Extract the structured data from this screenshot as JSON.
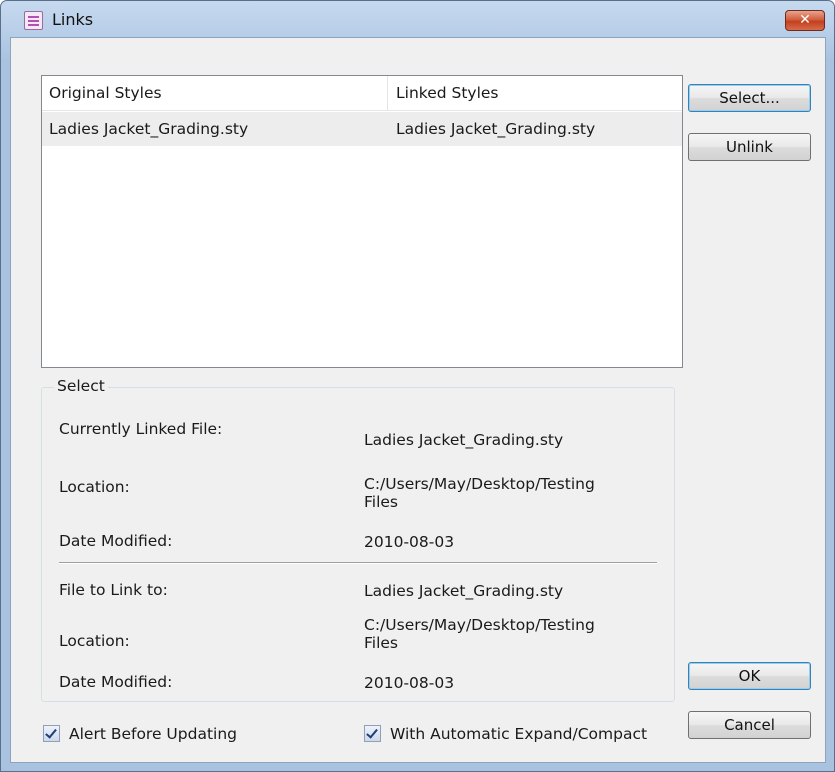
{
  "window": {
    "title": "Links",
    "close_symbol": "✕",
    "icon": "style-file-icon"
  },
  "list": {
    "columns": [
      "Original Styles",
      "Linked Styles"
    ],
    "rows": [
      {
        "original": "Ladies Jacket_Grading.sty",
        "linked": "Ladies Jacket_Grading.sty",
        "selected": true
      }
    ]
  },
  "buttons": {
    "select": "Select...",
    "unlink": "Unlink",
    "ok": "OK",
    "cancel": "Cancel"
  },
  "group": {
    "title": "Select",
    "current": {
      "file_label": "Currently Linked File:",
      "file_value": "Ladies Jacket_Grading.sty",
      "location_label": "Location:",
      "location_value_line1": "C:/Users/May/Desktop/Testing",
      "location_value_line2": "Files",
      "date_label": "Date Modified:",
      "date_value": "2010-08-03"
    },
    "target": {
      "file_label": "File to Link to:",
      "file_value": "Ladies Jacket_Grading.sty",
      "location_label": "Location:",
      "location_value_line1": "C:/Users/May/Desktop/Testing",
      "location_value_line2": "Files",
      "date_label": "Date Modified:",
      "date_value": "2010-08-03"
    }
  },
  "checkboxes": {
    "alert": {
      "label": "Alert Before Updating",
      "checked": true
    },
    "expand": {
      "label": "With Automatic Expand/Compact",
      "checked": true
    }
  }
}
